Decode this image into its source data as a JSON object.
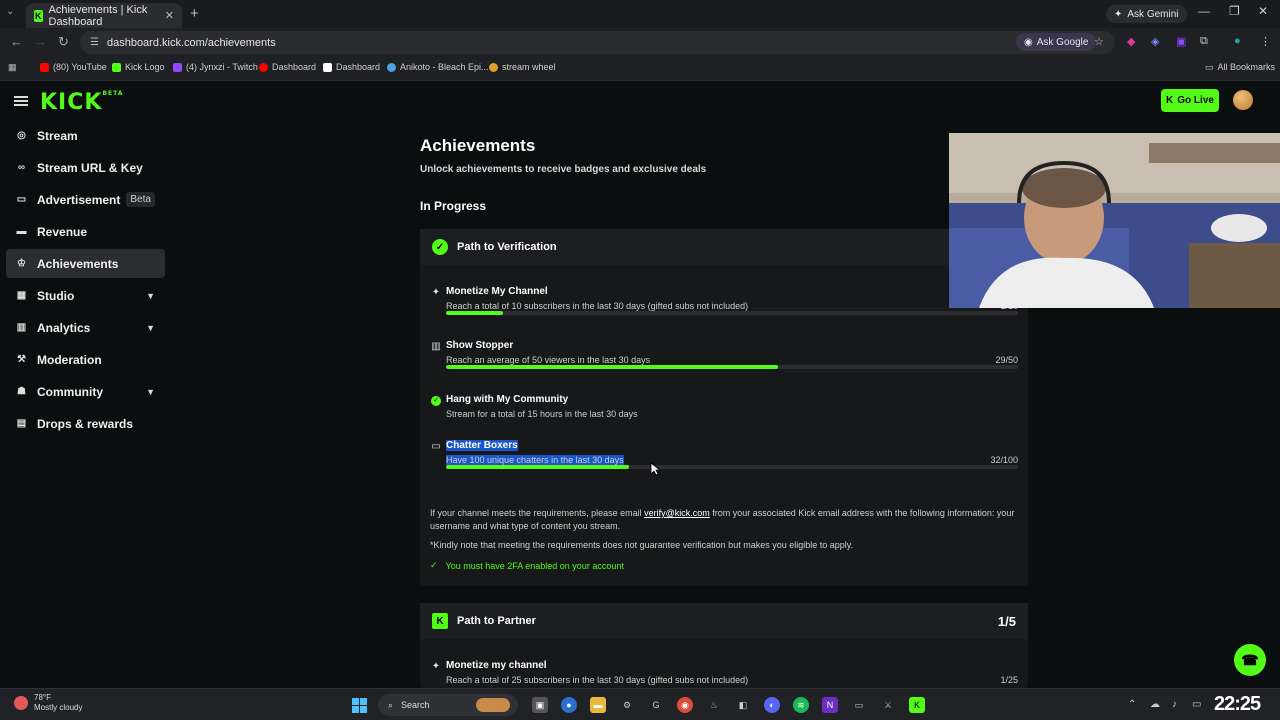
{
  "browser": {
    "tab_title": "Achievements | Kick Dashboard",
    "tab_close": "✕",
    "new_tab": "+",
    "gemini": "Ask Gemini",
    "url": "dashboard.kick.com/achievements",
    "ask_google": "Ask Google",
    "bookmarks": [
      {
        "label": "(80) YouTube",
        "color": "#ff0000"
      },
      {
        "label": "Kick Logo",
        "color": "#53fc18"
      },
      {
        "label": "(4) Jynxzi - Twitch",
        "color": "#9146ff"
      },
      {
        "label": "Dashboard",
        "color": "#ff0000"
      },
      {
        "label": "Dashboard",
        "color": "#ffffff"
      },
      {
        "label": "Anikoto - Bleach Epi...",
        "color": "#4aa3df"
      },
      {
        "label": "stream wheel",
        "color": "#e0a030"
      }
    ],
    "all_bookmarks": "All Bookmarks"
  },
  "header": {
    "logo": "KICK",
    "logo_tag": "BETA",
    "go_live": "Go Live"
  },
  "sidebar": {
    "items": [
      {
        "label": "Stream",
        "icon": "broadcast-icon"
      },
      {
        "label": "Stream URL & Key",
        "icon": "link-icon"
      },
      {
        "label": "Advertisement",
        "icon": "monitor-icon",
        "badge": "Beta"
      },
      {
        "label": "Revenue",
        "icon": "wallet-icon"
      },
      {
        "label": "Achievements",
        "icon": "trophy-icon",
        "active": true
      },
      {
        "label": "Studio",
        "icon": "grid-icon",
        "expandable": true
      },
      {
        "label": "Analytics",
        "icon": "chart-icon",
        "expandable": true
      },
      {
        "label": "Moderation",
        "icon": "hammer-icon"
      },
      {
        "label": "Community",
        "icon": "people-icon",
        "expandable": true
      },
      {
        "label": "Drops & rewards",
        "icon": "gift-icon"
      }
    ]
  },
  "main": {
    "title": "Achievements",
    "subtitle": "Unlock achievements to receive badges and exclusive deals",
    "section": "In Progress",
    "verification": {
      "title": "Path to Verification",
      "achievements": [
        {
          "title": "Monetize My Channel",
          "desc": "Reach a total of 10 subscribers in the last 30 days (gifted subs not included)",
          "progress": "1/10",
          "fraction": 0.1
        },
        {
          "title": "Show Stopper",
          "desc": "Reach an average of 50 viewers in the last 30 days",
          "progress": "29/50",
          "fraction": 0.58
        },
        {
          "title": "Hang with My Community",
          "desc": "Stream for a total of 15 hours in the last 30 days",
          "progress": "",
          "fraction": 1.0
        },
        {
          "title": "Chatter Boxers",
          "desc": "Have 100 unique chatters in the last 30 days",
          "progress": "32/100",
          "fraction": 0.32
        }
      ],
      "note1_before": "If your channel meets the requirements, please email ",
      "note1_link": "verify@kick.com",
      "note1_after": " from your associated Kick email address with the following information: your username and what type of content you stream.",
      "note2": "*Kindly note that meeting the requirements does not guarantee verification but makes you eligible to apply.",
      "requirement": "You must have 2FA enabled on your account"
    },
    "partner": {
      "title": "Path to Partner",
      "count": "1/5",
      "achievements": [
        {
          "title": "Monetize my channel",
          "desc": "Reach a total of 25 subscribers in the last 30 days (gifted subs not included)",
          "progress": "1/25",
          "fraction": 0.04
        }
      ]
    }
  },
  "taskbar": {
    "temp": "78°F",
    "weather": "Mostly cloudy",
    "search": "Search",
    "time": "22:25"
  }
}
